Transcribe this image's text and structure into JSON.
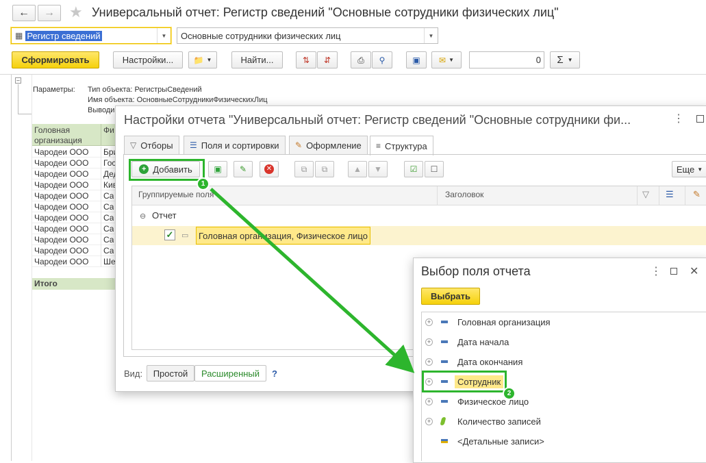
{
  "window": {
    "title": "Универсальный отчет: Регистр сведений \"Основные сотрудники физических лиц\"",
    "back_icon": "arrow-left-icon",
    "forward_icon": "arrow-right-icon",
    "star_icon": "star-icon"
  },
  "filters": {
    "object_type": "Регистр сведений",
    "object_name": "Основные сотрудники физических лиц"
  },
  "toolbar": {
    "generate": "Сформировать",
    "settings": "Настройки...",
    "find": "Найти...",
    "number_value": "0",
    "sum_symbol": "Σ"
  },
  "report": {
    "params_label": "Параметры:",
    "params": [
      "Тип объекта: РегистрыСведений",
      "Имя объекта: ОсновныеСотрудникиФизическихЛиц",
      "Выводи"
    ],
    "col1_header_line1": "Головная",
    "col1_header_line2": "организация",
    "col2_header": "Фи",
    "rows": [
      {
        "org": "Чародеи ООО",
        "emp": "Бри"
      },
      {
        "org": "Чародеи ООО",
        "emp": "Гос"
      },
      {
        "org": "Чародеи ООО",
        "emp": "Дед"
      },
      {
        "org": "Чародеи ООО",
        "emp": "Кив"
      },
      {
        "org": "Чародеи ООО",
        "emp": "Са"
      },
      {
        "org": "Чародеи ООО",
        "emp": "Са"
      },
      {
        "org": "Чародеи ООО",
        "emp": "Са"
      },
      {
        "org": "Чародеи ООО",
        "emp": "Са"
      },
      {
        "org": "Чародеи ООО",
        "emp": "Са"
      },
      {
        "org": "Чародеи ООО",
        "emp": "Са"
      },
      {
        "org": "Чародеи ООО",
        "emp": "Ше"
      }
    ],
    "total": "Итого"
  },
  "settings_dialog": {
    "title": "Настройки отчета \"Универсальный отчет: Регистр сведений \"Основные сотрудники фи...",
    "tabs": [
      "Отборы",
      "Поля и сортировки",
      "Оформление",
      "Структура"
    ],
    "add_button": "Добавить",
    "more_button": "Еще",
    "col_group_fields": "Группируемые поля",
    "col_header": "Заголовок",
    "tree_root": "Отчет",
    "tree_child": "Головная организация, Физическое лицо",
    "view_label": "Вид:",
    "view_simple": "Простой",
    "view_extended": "Расширенный",
    "help": "?"
  },
  "field_dialog": {
    "title": "Выбор поля отчета",
    "select_button": "Выбрать",
    "fields": [
      "Головная организация",
      "Дата начала",
      "Дата окончания",
      "Сотрудник",
      "Физическое лицо",
      "Количество записей",
      "<Детальные записи>"
    ]
  },
  "annotations": {
    "step1": "1",
    "step2": "2",
    "color": "#2db52d"
  }
}
